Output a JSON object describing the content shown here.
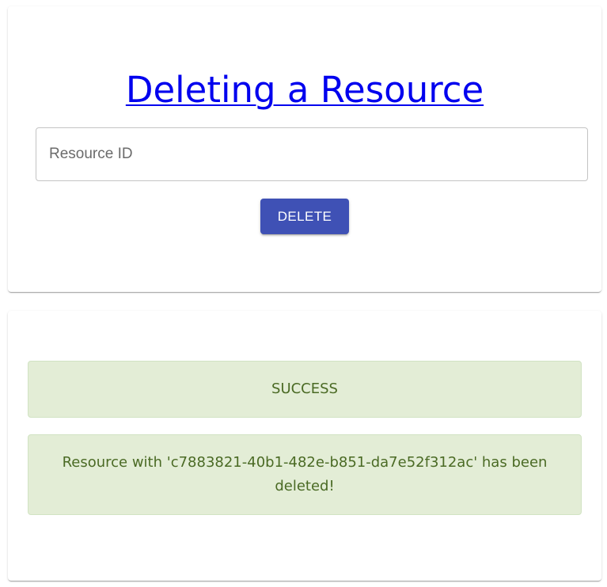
{
  "form": {
    "title": "Deleting a Resource",
    "resource_id_placeholder": "Resource ID",
    "resource_id_value": "",
    "delete_label": "DELETE"
  },
  "result": {
    "status": "SUCCESS",
    "message": "Resource with 'c7883821-40b1-482e-b851-da7e52f312ac' has been deleted!"
  },
  "colors": {
    "primary_button": "#3f51b5",
    "link": "#0000ee",
    "success_bg": "#e3edd6",
    "success_text": "#4a6a24"
  }
}
